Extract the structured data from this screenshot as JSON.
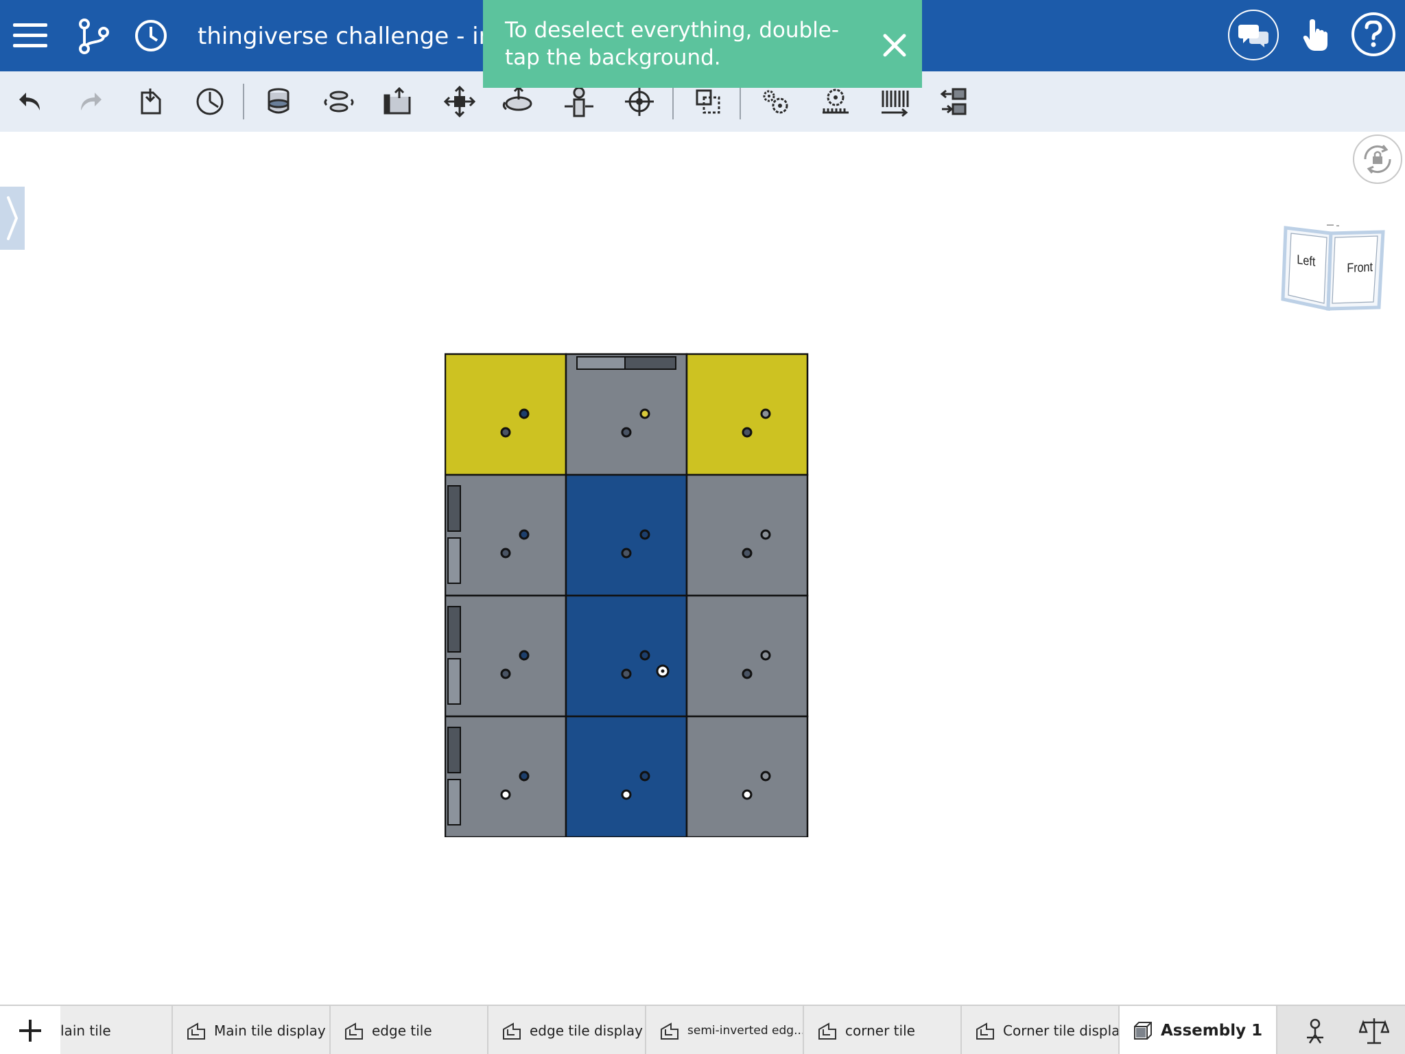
{
  "document": {
    "title": "thingiverse challenge - int"
  },
  "toast": {
    "message": "To deselect everything, double-tap the background.",
    "close_icon": "close-icon"
  },
  "colors": {
    "topbar": "#1c5baa",
    "toolbar": "#e7edf5",
    "toast": "#5cc39d",
    "tile_yellow": "#cdc222",
    "tile_gray": "#7d838b",
    "tile_blue": "#1b4d8b"
  },
  "viewcube": {
    "left_label": "Left",
    "front_label": "Front"
  },
  "tile_grid": {
    "rows": [
      [
        "yellow",
        "gray",
        "yellow"
      ],
      [
        "gray",
        "blue",
        "gray"
      ],
      [
        "gray",
        "blue",
        "gray"
      ],
      [
        "gray",
        "blue",
        "gray"
      ]
    ]
  },
  "tabs": [
    {
      "label": "lain tile",
      "icon": "part-studio-icon",
      "active": false
    },
    {
      "label": "Main tile display",
      "icon": "part-studio-icon",
      "active": false
    },
    {
      "label": "edge tile",
      "icon": "part-studio-icon",
      "active": false
    },
    {
      "label": "edge tile display",
      "icon": "part-studio-icon",
      "active": false
    },
    {
      "label": "semi-inverted edg...",
      "icon": "part-studio-icon",
      "active": false
    },
    {
      "label": "corner tile",
      "icon": "part-studio-icon",
      "active": false
    },
    {
      "label": "Corner tile display",
      "icon": "part-studio-icon",
      "active": false
    },
    {
      "label": "Assembly 1",
      "icon": "assembly-icon",
      "active": true
    }
  ]
}
